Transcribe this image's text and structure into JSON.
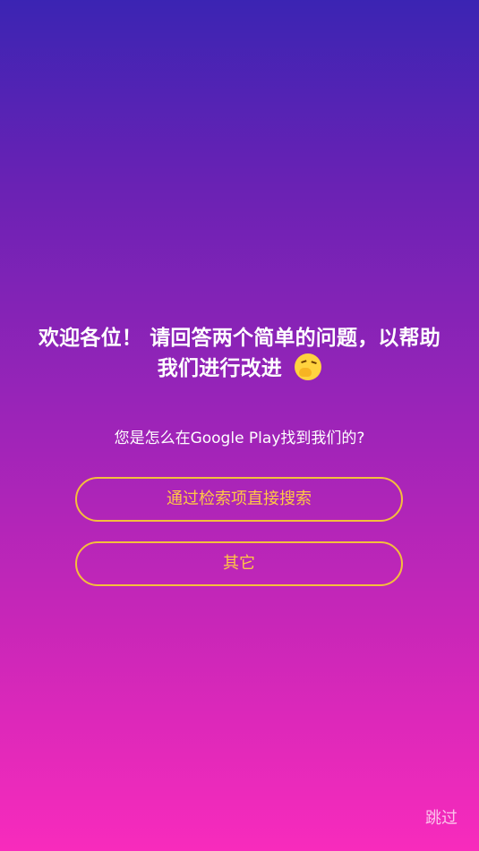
{
  "survey": {
    "title": "欢迎各位！ 请回答两个简单的问题，以帮助我们进行改进",
    "emoji_icon": "hugging-face-icon",
    "question": "您是怎么在Google Play找到我们的?",
    "options": [
      {
        "label": "通过检索项直接搜索"
      },
      {
        "label": "其它"
      }
    ],
    "skip_label": "跳过"
  },
  "colors": {
    "gradient_top": "#3b24b3",
    "gradient_bottom": "#f82bbc",
    "accent": "#f4bf3c",
    "text": "#ffffff"
  }
}
